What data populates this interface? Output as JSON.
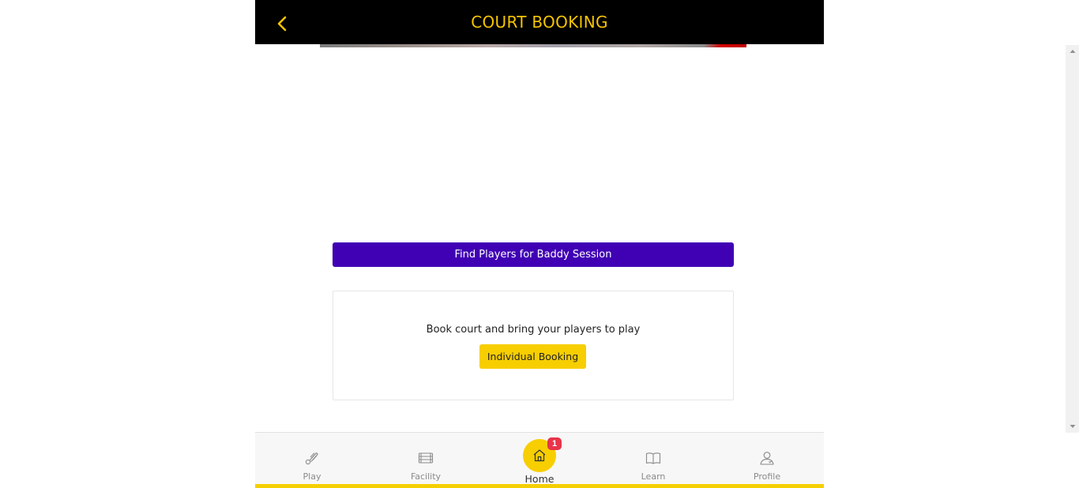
{
  "header": {
    "title": "COURT BOOKING",
    "back_icon": "chevron-left-icon"
  },
  "actions": {
    "find_players_label": "Find Players for Baddy Session"
  },
  "booking_card": {
    "description": "Book court and bring your players to play",
    "button_label": "Individual Booking"
  },
  "bottom_nav": {
    "items": [
      {
        "label": "Play",
        "icon": "shuttlecock-icon"
      },
      {
        "label": "Facility",
        "icon": "court-icon"
      },
      {
        "label": "Home",
        "icon": "home-icon",
        "badge": "1",
        "active": true
      },
      {
        "label": "Learn",
        "icon": "book-icon"
      },
      {
        "label": "Profile",
        "icon": "profile-icon"
      }
    ]
  },
  "colors": {
    "header_bg": "#000000",
    "header_text": "#f5c400",
    "primary_button": "#4000b4",
    "accent_yellow": "#f7ce00",
    "badge": "#e8344a"
  }
}
